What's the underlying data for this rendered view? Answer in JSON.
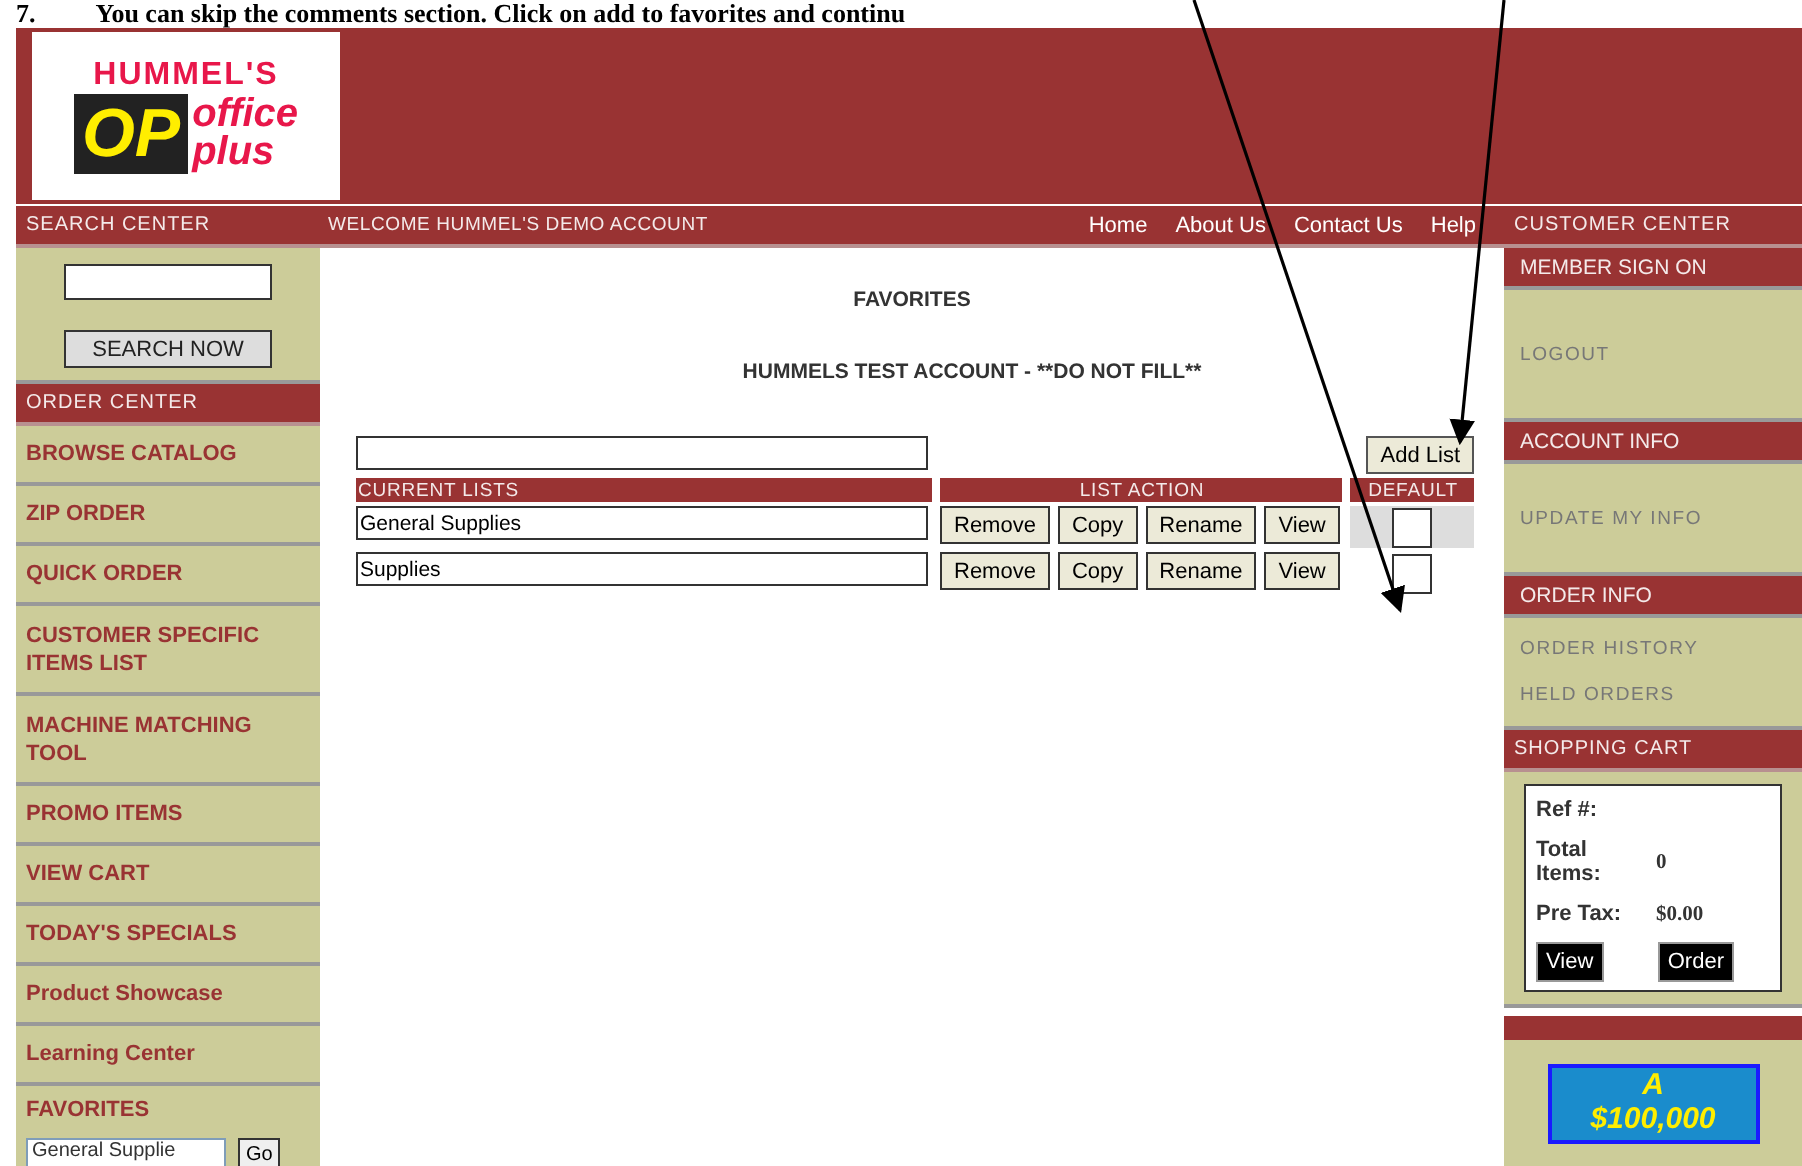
{
  "document_caption": {
    "number": "7.",
    "text": "You can skip the comments section.  Click on add to favorites and continu"
  },
  "header": {
    "logo": {
      "top": "HUMMEL'S",
      "mark": "OP",
      "word1": "office",
      "word2": "plus"
    }
  },
  "search_center": {
    "title": "SEARCH CENTER",
    "button": "SEARCH NOW"
  },
  "order_center": {
    "title": "ORDER CENTER",
    "items": [
      {
        "label": "BROWSE CATALOG"
      },
      {
        "label": "ZIP ORDER"
      },
      {
        "label": "QUICK ORDER"
      },
      {
        "label": "CUSTOMER SPECIFIC ITEMS LIST"
      },
      {
        "label": "MACHINE MATCHING TOOL"
      },
      {
        "label": "PROMO ITEMS"
      },
      {
        "label": "VIEW CART"
      },
      {
        "label": "TODAY'S SPECIALS"
      },
      {
        "label": "Product Showcase"
      },
      {
        "label": "Learning Center"
      },
      {
        "label": "FAVORITES",
        "select": "General Supplie",
        "go": "Go"
      }
    ]
  },
  "nav": {
    "welcome": "WELCOME HUMMEL'S DEMO ACCOUNT",
    "links": [
      "Home",
      "About Us",
      "Contact Us",
      "Help"
    ]
  },
  "content": {
    "title": "FAVORITES",
    "account": "HUMMELS TEST ACCOUNT - **DO NOT FILL**",
    "add_button": "Add List",
    "columns": [
      "CURRENT LISTS",
      "LIST ACTION",
      "DEFAULT"
    ],
    "rows": [
      {
        "name": "General Supplies",
        "actions": [
          "Remove",
          "Copy",
          "Rename",
          "View"
        ],
        "selected": false,
        "highlighted": true
      },
      {
        "name": "Supplies",
        "actions": [
          "Remove",
          "Copy",
          "Rename",
          "View"
        ],
        "selected": false,
        "highlighted": false
      }
    ]
  },
  "customer_center": {
    "title": "CUSTOMER CENTER",
    "sections": [
      {
        "title": "MEMBER SIGN ON",
        "links": [
          "LOGOUT"
        ]
      },
      {
        "title": "ACCOUNT INFO",
        "links": [
          "UPDATE MY INFO"
        ]
      },
      {
        "title": "ORDER INFO",
        "links": [
          "ORDER HISTORY",
          "HELD ORDERS"
        ]
      }
    ]
  },
  "shopping_cart": {
    "title": "SHOPPING CART",
    "ref_label": "Ref #:",
    "items_label": "Total Items:",
    "items_value": "0",
    "pretax_label": "Pre Tax:",
    "pretax_value": "$0.00",
    "buttons": [
      "View",
      "Order"
    ]
  },
  "ad": {
    "line1": "A",
    "line2": "$100,000"
  }
}
